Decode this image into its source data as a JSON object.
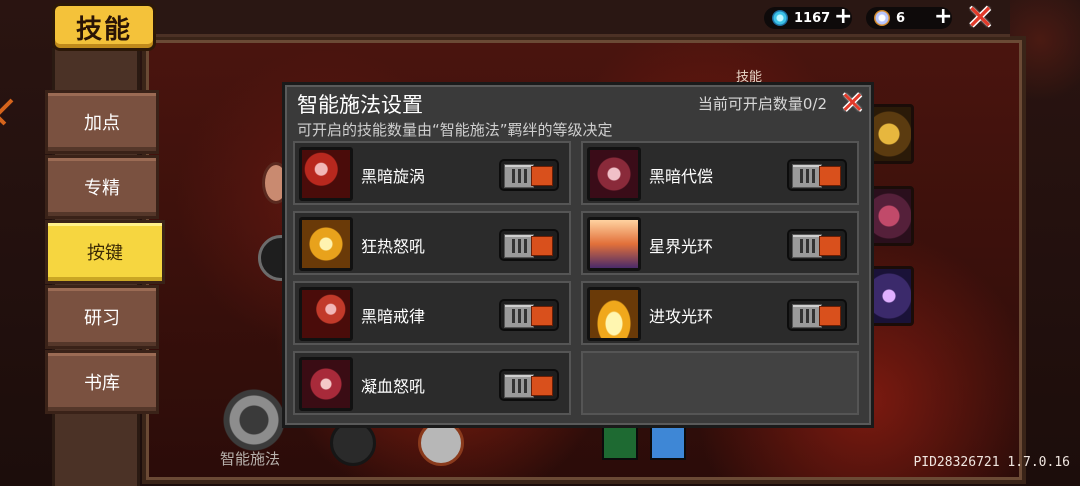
{
  "header": {
    "title": "技能",
    "gems": "1167",
    "crystals": "6",
    "add_label": "+"
  },
  "tabs": [
    {
      "label": "加点",
      "active": false
    },
    {
      "label": "专精",
      "active": false
    },
    {
      "label": "按键",
      "active": true
    },
    {
      "label": "研习",
      "active": false
    },
    {
      "label": "书库",
      "active": false
    }
  ],
  "background": {
    "partial_label": "技能",
    "smart_cast_label": "智能施法"
  },
  "dialog": {
    "title": "智能施法设置",
    "subtitle": "可开启的技能数量由“智能施法”羁绊的等级决定",
    "count_label": "当前可开启数量0/2",
    "skills": [
      {
        "name": "黑暗旋涡",
        "icon": "dark-vortex-icon",
        "enabled": false
      },
      {
        "name": "黑暗代偿",
        "icon": "dark-compensation-icon",
        "enabled": false
      },
      {
        "name": "狂热怒吼",
        "icon": "fanatic-roar-icon",
        "enabled": false
      },
      {
        "name": "星界光环",
        "icon": "astral-aura-icon",
        "enabled": false
      },
      {
        "name": "黑暗戒律",
        "icon": "dark-discipline-icon",
        "enabled": false
      },
      {
        "name": "进攻光环",
        "icon": "attack-aura-icon",
        "enabled": false
      },
      {
        "name": "凝血怒吼",
        "icon": "blood-roar-icon",
        "enabled": false
      }
    ]
  },
  "footer": {
    "pid": "PID28326721 1.7.0.16"
  },
  "colors": {
    "accent_yellow": "#f4c23a",
    "toggle_off": "#d9501c",
    "close_red": "#e23a2a"
  }
}
